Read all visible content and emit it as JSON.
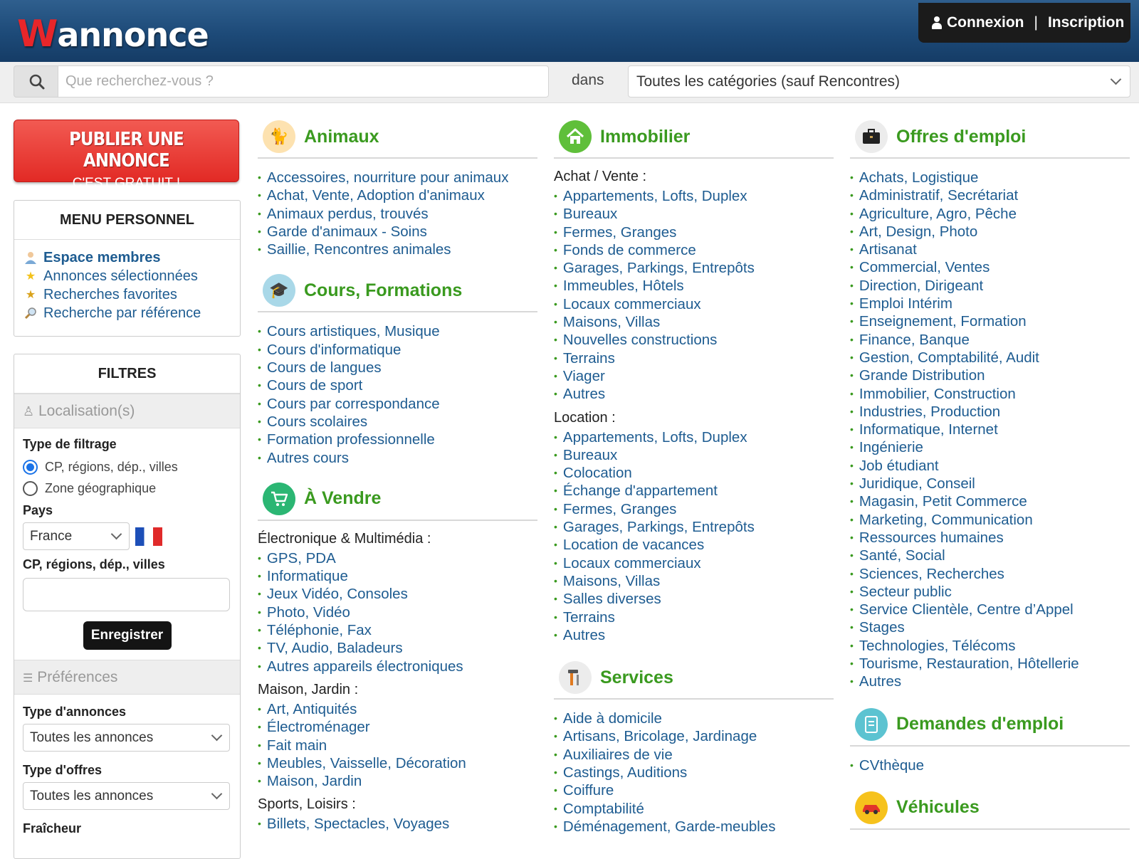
{
  "header": {
    "logo": "Wannonce",
    "login": "Connexion",
    "separator": "|",
    "register": "Inscription"
  },
  "search": {
    "placeholder": "Que recherchez-vous ?",
    "in_label": "dans",
    "category": "Toutes les catégories (sauf Rencontres)"
  },
  "publish": {
    "line1": "PUBLIER UNE ANNONCE",
    "line2": "C'EST GRATUIT !"
  },
  "menu": {
    "title": "MENU PERSONNEL",
    "items": [
      "Espace membres",
      "Annonces sélectionnées",
      "Recherches favorites",
      "Recherche par référence"
    ]
  },
  "filters": {
    "title": "FILTRES",
    "localisation": "Localisation(s)",
    "filter_type": "Type de filtrage",
    "opt1": "CP, régions, dép., villes",
    "opt2": "Zone géographique",
    "country_label": "Pays",
    "country": "France",
    "cp_label": "CP, régions, dép., villes",
    "save": "Enregistrer",
    "preferences": "Préférences",
    "ad_type_label": "Type d'annonces",
    "ad_type": "Toutes les annonces",
    "offer_type_label": "Type d'offres",
    "offer_type": "Toutes les annonces",
    "freshness_label": "Fraîcheur"
  },
  "col1": {
    "animaux": {
      "title": "Animaux",
      "items": [
        "Accessoires, nourriture pour animaux",
        "Achat, Vente, Adoption d'animaux",
        "Animaux perdus, trouvés",
        "Garde d'animaux - Soins",
        "Saillie, Rencontres animales"
      ]
    },
    "cours": {
      "title": "Cours, Formations",
      "items": [
        "Cours artistiques, Musique",
        "Cours d'informatique",
        "Cours de langues",
        "Cours de sport",
        "Cours par correspondance",
        "Cours scolaires",
        "Formation professionnelle",
        "Autres cours"
      ]
    },
    "vendre": {
      "title": "À Vendre",
      "sub1": "Électronique & Multimédia :",
      "items1": [
        "GPS, PDA",
        "Informatique",
        "Jeux Vidéo, Consoles",
        "Photo, Vidéo",
        "Téléphonie, Fax",
        "TV, Audio, Baladeurs",
        "Autres appareils électroniques"
      ],
      "sub2": "Maison, Jardin :",
      "items2": [
        "Art, Antiquités",
        "Électroménager",
        "Fait main",
        "Meubles, Vaisselle, Décoration",
        "Maison, Jardin"
      ],
      "sub3": "Sports, Loisirs :",
      "items3": [
        "Billets, Spectacles, Voyages"
      ]
    }
  },
  "col2": {
    "immo": {
      "title": "Immobilier",
      "sub1": "Achat / Vente :",
      "items1": [
        "Appartements, Lofts, Duplex",
        "Bureaux",
        "Fermes, Granges",
        "Fonds de commerce",
        "Garages, Parkings, Entrepôts",
        "Immeubles, Hôtels",
        "Locaux commerciaux",
        "Maisons, Villas",
        "Nouvelles constructions",
        "Terrains",
        "Viager",
        "Autres"
      ],
      "sub2": "Location :",
      "items2": [
        "Appartements, Lofts, Duplex",
        "Bureaux",
        "Colocation",
        "Échange d'appartement",
        "Fermes, Granges",
        "Garages, Parkings, Entrepôts",
        "Location de vacances",
        "Locaux commerciaux",
        "Maisons, Villas",
        "Salles diverses",
        "Terrains",
        "Autres"
      ]
    },
    "services": {
      "title": "Services",
      "items": [
        "Aide à domicile",
        "Artisans, Bricolage, Jardinage",
        "Auxiliaires de vie",
        "Castings, Auditions",
        "Coiffure",
        "Comptabilité",
        "Déménagement, Garde-meubles"
      ]
    }
  },
  "col3": {
    "emploi": {
      "title": "Offres d'emploi",
      "items": [
        "Achats, Logistique",
        "Administratif, Secrétariat",
        "Agriculture, Agro, Pêche",
        "Art, Design, Photo",
        "Artisanat",
        "Commercial, Ventes",
        "Direction, Dirigeant",
        "Emploi Intérim",
        "Enseignement, Formation",
        "Finance, Banque",
        "Gestion, Comptabilité, Audit",
        "Grande Distribution",
        "Immobilier, Construction",
        "Industries, Production",
        "Informatique, Internet",
        "Ingénierie",
        "Job étudiant",
        "Juridique, Conseil",
        "Magasin, Petit Commerce",
        "Marketing, Communication",
        "Ressources humaines",
        "Santé, Social",
        "Sciences, Recherches",
        "Secteur public",
        "Service Clientèle, Centre d’Appel",
        "Stages",
        "Technologies, Télécoms",
        "Tourisme, Restauration, Hôtellerie",
        "Autres"
      ]
    },
    "demandes": {
      "title": "Demandes d'emploi",
      "items": [
        "CVthèque"
      ]
    },
    "vehicules": {
      "title": "Véhicules"
    }
  }
}
